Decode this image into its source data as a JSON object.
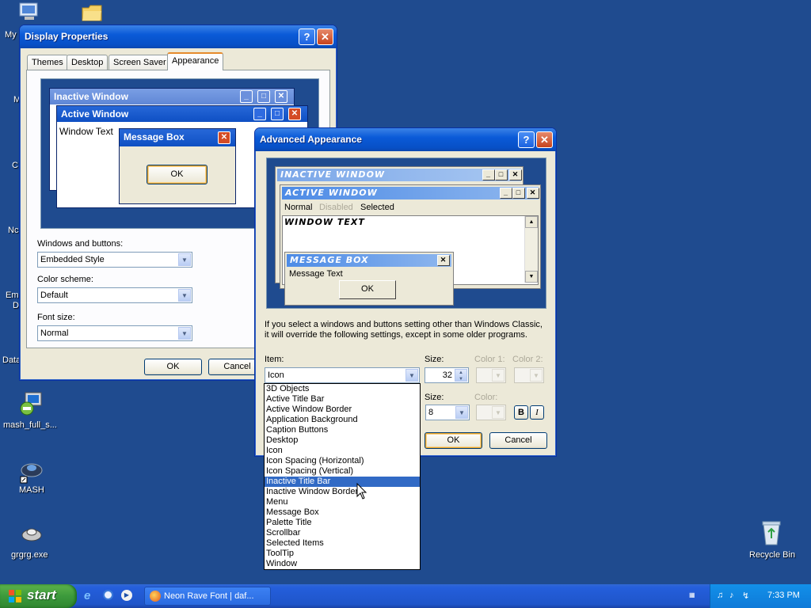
{
  "desktop": {
    "icons": [
      {
        "label": "My",
        "icon": "computer-icon"
      },
      {
        "label": "",
        "icon": "folder-icon"
      },
      {
        "label": "M",
        "icon": "partial-icon"
      },
      {
        "label": "C",
        "icon": "partial-icon"
      },
      {
        "label": "Nc",
        "icon": "partial-icon"
      },
      {
        "label": "Em",
        "icon": "partial-icon"
      },
      {
        "label": "D",
        "icon": "partial-icon"
      },
      {
        "label": "Data",
        "icon": "partial-icon"
      },
      {
        "label": "mash_full_s...",
        "icon": "installer-icon"
      },
      {
        "label": "MASH",
        "icon": "mash-icon"
      },
      {
        "label": "grgrg.exe",
        "icon": "exe-icon"
      },
      {
        "label": "Recycle Bin",
        "icon": "recycle-bin-icon"
      }
    ]
  },
  "display_properties": {
    "title": "Display Properties",
    "tabs": [
      "Themes",
      "Desktop",
      "Screen Saver",
      "Appearance"
    ],
    "selected_tab": "Appearance",
    "preview": {
      "inactive_title": "Inactive Window",
      "active_title": "Active Window",
      "window_text": "Window Text",
      "msgbox_title": "Message Box",
      "ok_label": "OK"
    },
    "windows_buttons_label": "Windows and buttons:",
    "windows_buttons_value": "Embedded Style",
    "color_scheme_label": "Color scheme:",
    "color_scheme_value": "Default",
    "font_size_label": "Font size:",
    "font_size_value": "Normal",
    "ok_label": "OK",
    "cancel_label": "Cancel"
  },
  "advanced_appearance": {
    "title": "Advanced Appearance",
    "preview": {
      "inactive_title": "INACTIVE WINDOW",
      "active_title": "ACTIVE WINDOW",
      "menu_normal": "Normal",
      "menu_disabled": "Disabled",
      "menu_selected": "Selected",
      "window_text": "WINDOW TEXT",
      "msgbox_title": "MESSAGE BOX",
      "message_text": "Message Text",
      "ok_label": "OK"
    },
    "info_text_line1": "If you select a windows and buttons setting other than Windows Classic,",
    "info_text_line2": "it will override the following settings, except in some older programs.",
    "item_label": "Item:",
    "item_value": "Icon",
    "size_label": "Size:",
    "size_value": "32",
    "color1_label": "Color 1:",
    "color2_label": "Color 2:",
    "font_size_label": "Size:",
    "font_size_value": "8",
    "font_color_label": "Color:",
    "bold_label": "B",
    "italic_label": "I",
    "ok_label": "OK",
    "cancel_label": "Cancel",
    "item_options": [
      "3D Objects",
      "Active Title Bar",
      "Active Window Border",
      "Application Background",
      "Caption Buttons",
      "Desktop",
      "Icon",
      "Icon Spacing (Horizontal)",
      "Icon Spacing (Vertical)",
      "Inactive Title Bar",
      "Inactive Window Border",
      "Menu",
      "Message Box",
      "Palette Title",
      "Scrollbar",
      "Selected Items",
      "ToolTip",
      "Window"
    ],
    "highlighted_option": "Inactive Title Bar"
  },
  "taskbar": {
    "start_label": "start",
    "task_label": "Neon Rave Font | daf...",
    "clock": "7:33 PM"
  },
  "colors": {
    "desktop": "#1f4b8f",
    "xp_blue": "#0a5ad8",
    "selection": "#316ac5",
    "start_green": "#3c9a3c"
  }
}
